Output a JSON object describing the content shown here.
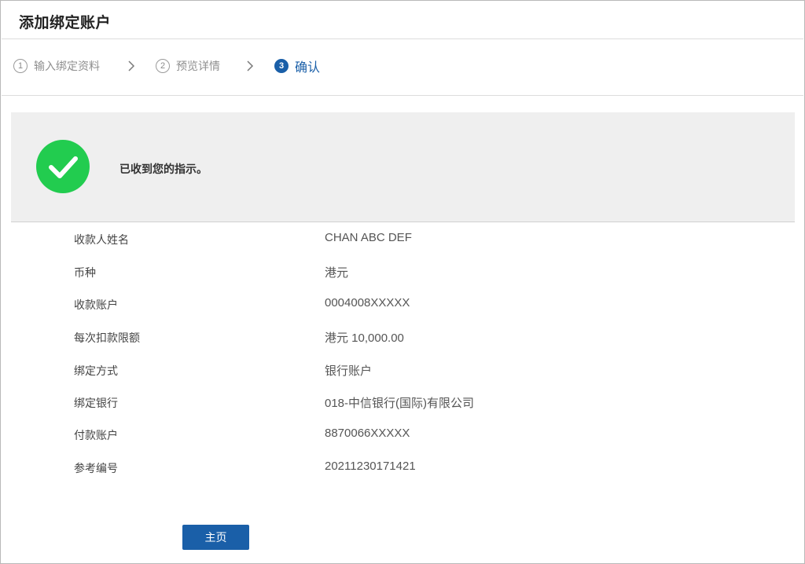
{
  "header": {
    "title": "添加绑定账户"
  },
  "steps": [
    {
      "num": "1",
      "label": "输入绑定资料"
    },
    {
      "num": "2",
      "label": "预览详情"
    },
    {
      "num": "3",
      "label": "确认"
    }
  ],
  "active_step": 3,
  "success": {
    "message": "已收到您的指示。",
    "icon": "check-circle-icon",
    "color": "#22cc4f"
  },
  "details": [
    {
      "label": "收款人姓名",
      "value": "CHAN ABC DEF"
    },
    {
      "label": "币种",
      "value": "港元"
    },
    {
      "label": "收款账户",
      "value": "0004008XXXXX"
    },
    {
      "label": "每次扣款限额",
      "value": "港元 10,000.00"
    },
    {
      "label": "绑定方式",
      "value": "银行账户"
    },
    {
      "label": "绑定银行",
      "value": "018-中信银行(国际)有限公司"
    },
    {
      "label": "付款账户",
      "value": "8870066XXXXX"
    },
    {
      "label": "参考编号",
      "value": "20211230171421"
    }
  ],
  "actions": {
    "home_label": "主页"
  },
  "colors": {
    "accent": "#1a5fa8",
    "success": "#22cc4f",
    "panel_bg": "#efefef"
  }
}
